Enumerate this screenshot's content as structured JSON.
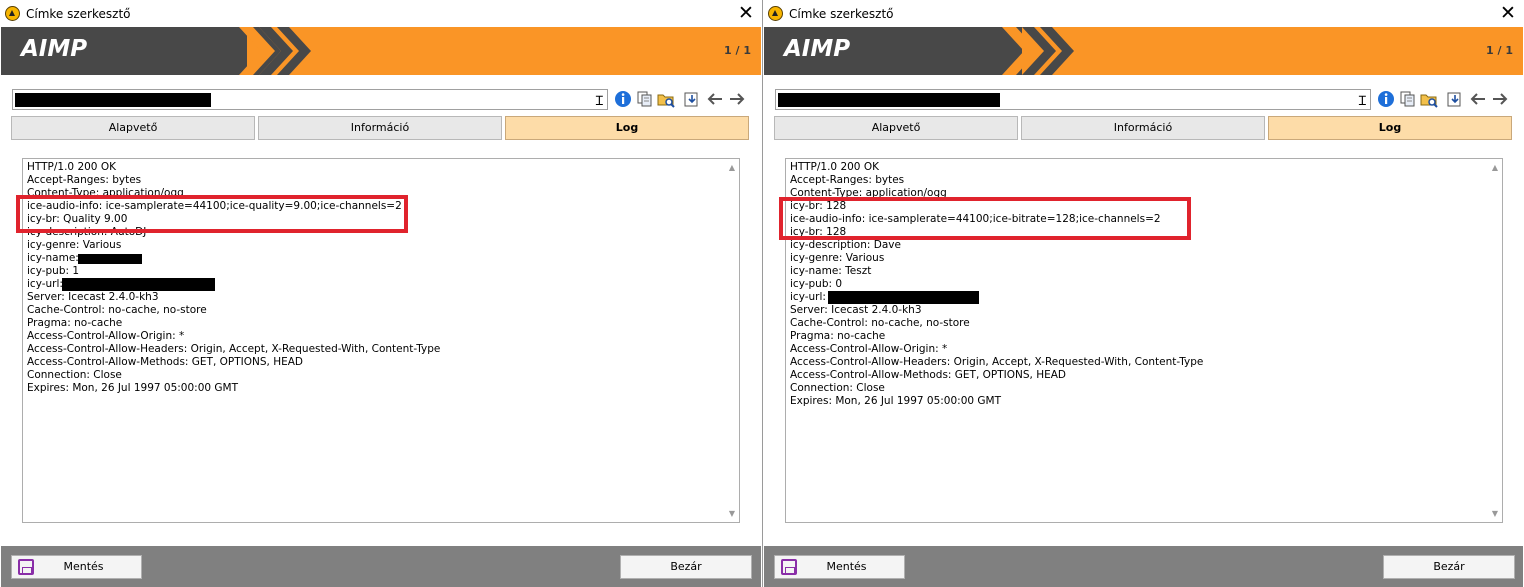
{
  "windows": [
    {
      "title": "Címke szerkesztő",
      "logo": "AIMP",
      "page_count": "1 / 1",
      "tabs": [
        {
          "label": "Alapvető",
          "active": false
        },
        {
          "label": "Információ",
          "active": false
        },
        {
          "label": "Log",
          "active": true
        }
      ],
      "log_lines": [
        "HTTP/1.0 200 OK",
        "Accept-Ranges: bytes",
        "Content-Type: application/ogg",
        "ice-audio-info: ice-samplerate=44100;ice-quality=9.00;ice-channels=2",
        "icy-br: Quality 9.00",
        "icy-description: AutoDJ",
        "icy-genre: Various",
        "icy-name: ",
        "icy-pub: 1",
        "icy-url:",
        "Server: Icecast 2.4.0-kh3",
        "Cache-Control: no-cache, no-store",
        "Pragma: no-cache",
        "Access-Control-Allow-Origin: *",
        "Access-Control-Allow-Headers: Origin, Accept, X-Requested-With, Content-Type",
        "Access-Control-Allow-Methods: GET, OPTIONS, HEAD",
        "Connection: Close",
        "Expires: Mon, 26 Jul 1997 05:00:00 GMT"
      ],
      "save_label": "Mentés",
      "close_label": "Bezár"
    },
    {
      "title": "Címke szerkesztő",
      "logo": "AIMP",
      "page_count": "1 / 1",
      "tabs": [
        {
          "label": "Alapvető",
          "active": false
        },
        {
          "label": "Információ",
          "active": false
        },
        {
          "label": "Log",
          "active": true
        }
      ],
      "log_lines": [
        "HTTP/1.0 200 OK",
        "Accept-Ranges: bytes",
        "Content-Type: application/ogg",
        "icy-br: 128",
        "ice-audio-info: ice-samplerate=44100;ice-bitrate=128;ice-channels=2",
        "icy-br: 128",
        "icy-description: Dave",
        "icy-genre: Various",
        "icy-name: Teszt",
        "icy-pub: 0",
        "icy-url:",
        "Server: Icecast 2.4.0-kh3",
        "Cache-Control: no-cache, no-store",
        "Pragma: no-cache",
        "Access-Control-Allow-Origin: *",
        "Access-Control-Allow-Headers: Origin, Accept, X-Requested-With, Content-Type",
        "Access-Control-Allow-Methods: GET, OPTIONS, HEAD",
        "Connection: Close",
        "Expires: Mon, 26 Jul 1997 05:00:00 GMT"
      ],
      "save_label": "Mentés",
      "close_label": "Bezár"
    }
  ],
  "colors": {
    "banner_orange": "#fa9526",
    "banner_dark": "#484848",
    "active_tab": "#fddca8",
    "highlight_red": "#e0232d",
    "footer_gray": "#808080"
  },
  "icons": [
    "aimp-logo-icon",
    "close-icon",
    "text-cursor-icon",
    "info-icon",
    "copy-icon",
    "find-folder-icon",
    "download-icon",
    "arrow-left-icon",
    "arrow-right-icon",
    "save-icon"
  ]
}
